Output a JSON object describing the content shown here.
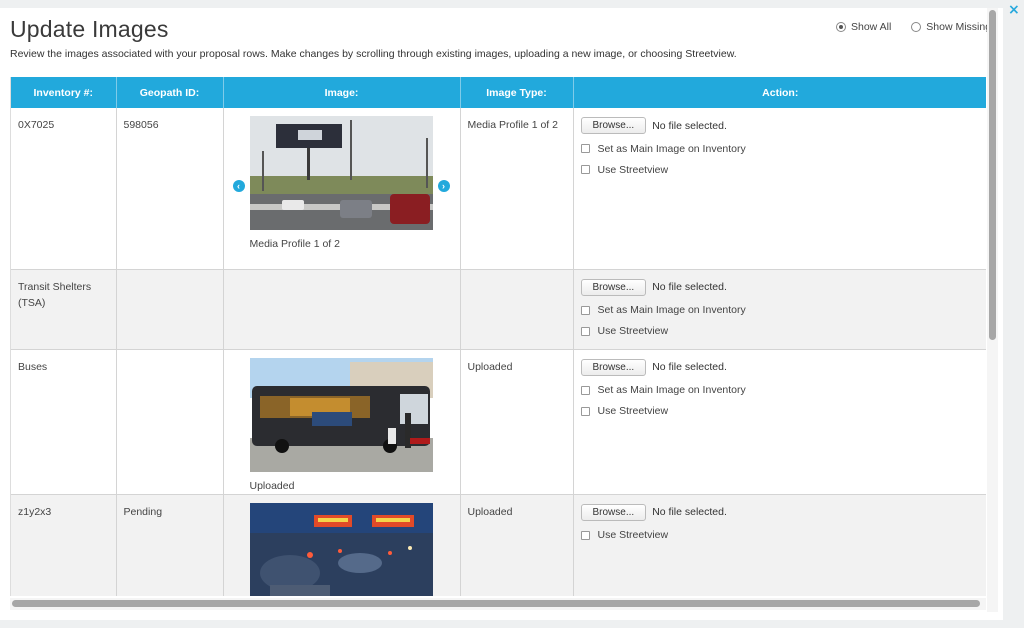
{
  "header": {
    "title": "Update Images",
    "subtitle": "Review the images associated with your proposal rows. Make changes by scrolling through existing images, uploading a new image, or choosing Streetview.",
    "filters": [
      {
        "label": "Show All",
        "checked": true
      },
      {
        "label": "Show Missing",
        "checked": false
      }
    ]
  },
  "table": {
    "columns": [
      "Inventory #:",
      "Geopath ID:",
      "Image:",
      "Image Type:",
      "Action:"
    ],
    "rows": [
      {
        "inventory": "0X7025",
        "geopath": "598056",
        "image_caption": "Media Profile 1 of 2",
        "image_type": "Media Profile 1 of 2",
        "image": "billboard-photo",
        "has_arrows": true
      },
      {
        "inventory": "Transit Shelters (TSA)",
        "geopath": "",
        "image_caption": "",
        "image_type": "",
        "image": "",
        "has_arrows": false
      },
      {
        "inventory": "Buses",
        "geopath": "",
        "image_caption": "Uploaded",
        "image_type": "Uploaded",
        "image": "bus-photo",
        "has_arrows": false
      },
      {
        "inventory": "z1y2x3",
        "geopath": "Pending",
        "image_caption": "",
        "image_type": "Uploaded",
        "image": "street-night-photo",
        "has_arrows": false
      }
    ]
  },
  "action": {
    "browse_label": "Browse...",
    "file_status": "No file selected.",
    "set_main_label": "Set as Main Image on Inventory",
    "streetview_label": "Use Streetview"
  },
  "colors": {
    "header_blue": "#22a9dc",
    "row_alt": "#f2f2f2"
  },
  "icons": {
    "close": "close-icon",
    "prev": "chevron-left-icon",
    "next": "chevron-right-icon"
  }
}
